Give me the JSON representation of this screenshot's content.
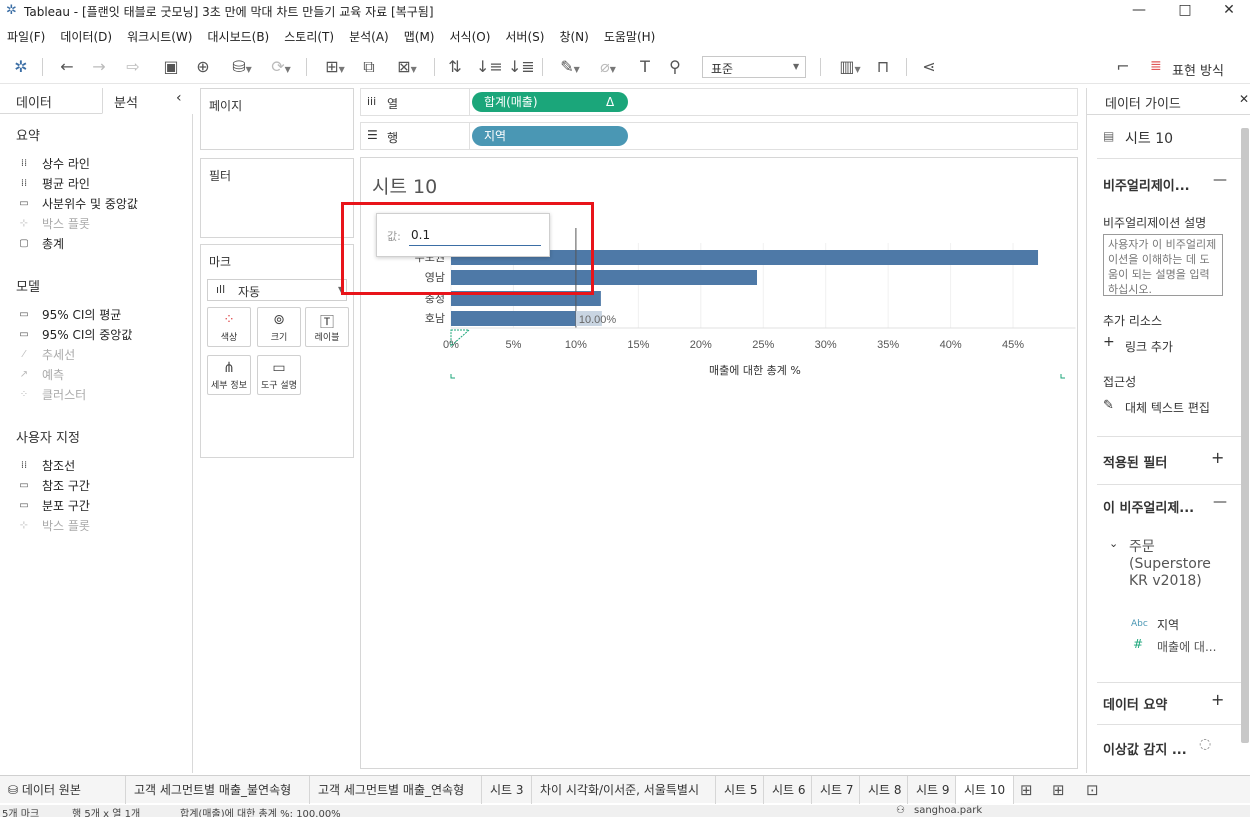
{
  "window": {
    "title": "Tableau - [플랜잇 태블로 굿모닝] 3초 만에 막대 차트 만들기 교육 자료 [복구됨]",
    "min": "—",
    "max": "□",
    "close": "✕"
  },
  "menu": [
    "파일(F)",
    "데이터(D)",
    "워크시트(W)",
    "대시보드(B)",
    "스토리(T)",
    "분석(A)",
    "맵(M)",
    "서식(O)",
    "서버(S)",
    "창(N)",
    "도움말(H)"
  ],
  "toolbar": {
    "fit": "표준",
    "show_me": "표현 방식"
  },
  "left": {
    "tab_data": "데이터",
    "tab_analysis": "분석",
    "collapse": "‹",
    "summary_title": "요약",
    "summary": [
      {
        "label": "상수 라인",
        "disabled": false
      },
      {
        "label": "평균 라인",
        "disabled": false
      },
      {
        "label": "사분위수 및 중앙값",
        "disabled": false
      },
      {
        "label": "박스 플롯",
        "disabled": true
      },
      {
        "label": "총계",
        "disabled": false
      }
    ],
    "model_title": "모델",
    "model": [
      {
        "label": "95% CI의 평균",
        "disabled": false
      },
      {
        "label": "95% CI의 중앙값",
        "disabled": false
      },
      {
        "label": "추세선",
        "disabled": true
      },
      {
        "label": "예측",
        "disabled": true
      },
      {
        "label": "클러스터",
        "disabled": true
      }
    ],
    "custom_title": "사용자 지정",
    "custom": [
      {
        "label": "참조선",
        "disabled": false
      },
      {
        "label": "참조 구간",
        "disabled": false
      },
      {
        "label": "분포 구간",
        "disabled": false
      },
      {
        "label": "박스 플롯",
        "disabled": true
      }
    ]
  },
  "shelves": {
    "pages": "페이지",
    "filters": "필터",
    "marks": "마크",
    "mark_type": "자동",
    "mark_buttons": [
      "색상",
      "크기",
      "레이블",
      "세부 정보",
      "도구 설명"
    ],
    "columns_label": "열",
    "rows_label": "행",
    "columns_pill": "합계(매출)",
    "columns_delta": "Δ",
    "rows_pill": "지역"
  },
  "sheet": {
    "title": "시트 10",
    "edit_label": "값:",
    "edit_value": "0.1",
    "refline_label": "10.00%",
    "axis_title": "매출에 대한 총계 %"
  },
  "chart_data": {
    "type": "bar",
    "orientation": "horizontal",
    "categories": [
      "수도권",
      "영남",
      "충청",
      "호남"
    ],
    "values": [
      0.47,
      0.245,
      0.12,
      0.12
    ],
    "xticks": [
      "0%",
      "5%",
      "10%",
      "15%",
      "20%",
      "25%",
      "30%",
      "35%",
      "40%",
      "45%"
    ],
    "xlim": [
      0,
      0.5
    ],
    "reference_line": 0.1,
    "bar_color": "#4e79a7",
    "xlabel": "매출에 대한 총계 %"
  },
  "right": {
    "title": "데이터 가이드",
    "sheet": "시트 10",
    "viz_section": "비주얼리제이...",
    "viz_desc_label": "비주얼리제이션 설명",
    "viz_desc_placeholder": "사용자가 이 비주얼리제이션을 이해하는 데 도움이 되는 설명을 입력하십시오.",
    "more_resources": "추가 리소스",
    "add_link": "링크 추가",
    "accessibility": "접근성",
    "edit_alt": "대체 텍스트 편집",
    "applied_filters": "적용된 필터",
    "this_viz": "이 비주얼리제...",
    "datasource": "주문 (Superstore KR v2018)",
    "field1_type": "Abc",
    "field1": "지역",
    "field2_type": "#",
    "field2": "매출에 대...",
    "data_summary": "데이터 요약",
    "outlier": "이상값 감지 ..."
  },
  "tabs": [
    "데이터 원본",
    "고객 세그먼트별 매출_불연속형",
    "고객 세그먼트별 매출_연속형",
    "시트 3",
    "차이 시각화/이서준, 서울특별시",
    "시트 5",
    "시트 6",
    "시트 7",
    "시트 8",
    "시트 9",
    "시트 10"
  ],
  "status": {
    "marks": "5개 마크",
    "rows": "행 5개 x 열 1개",
    "sum": "합계(매출)에 대한 총계 %: 100.00%",
    "user": "sanghoa.park"
  },
  "colors": {
    "green_pill": "#1ba67a",
    "blue_pill": "#4a97b4",
    "bar": "#4e79a7",
    "highlight": "#e8141a"
  }
}
